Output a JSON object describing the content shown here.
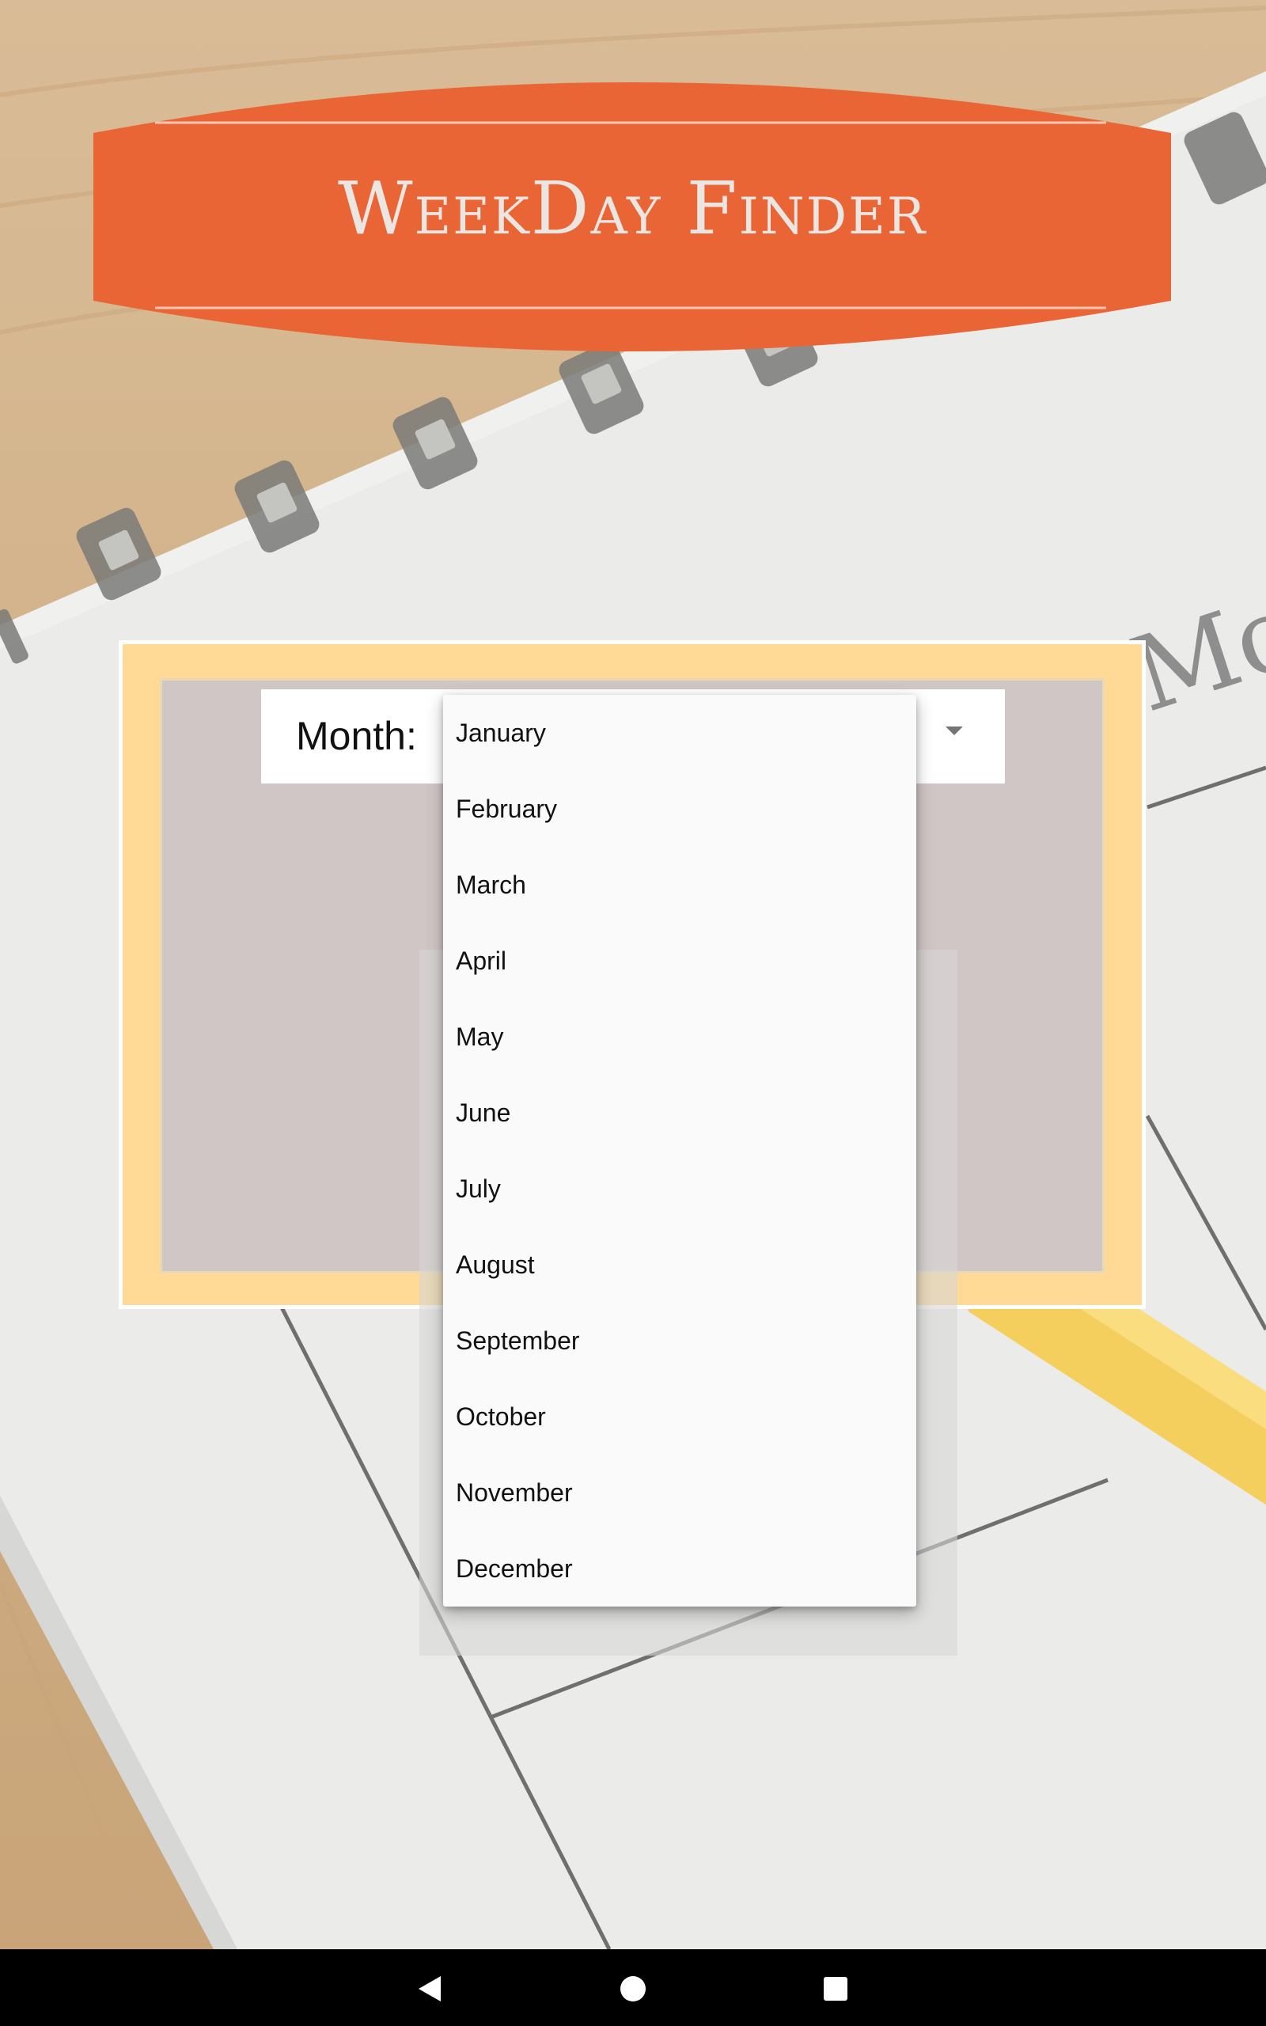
{
  "app": {
    "title": "WeekDay Finder"
  },
  "form": {
    "month_label": "Month:"
  },
  "dropdown": {
    "options": [
      "January",
      "February",
      "March",
      "April",
      "May",
      "June",
      "July",
      "August",
      "September",
      "October",
      "November",
      "December"
    ]
  },
  "colors": {
    "banner": "#ea6535",
    "card_frame": "#ffd995",
    "card_inner": "#d1c6c6",
    "menu_bg": "#fafafa",
    "navbar": "#000000"
  },
  "navbar": {
    "icons": [
      "back-icon",
      "home-icon",
      "recents-icon"
    ]
  }
}
